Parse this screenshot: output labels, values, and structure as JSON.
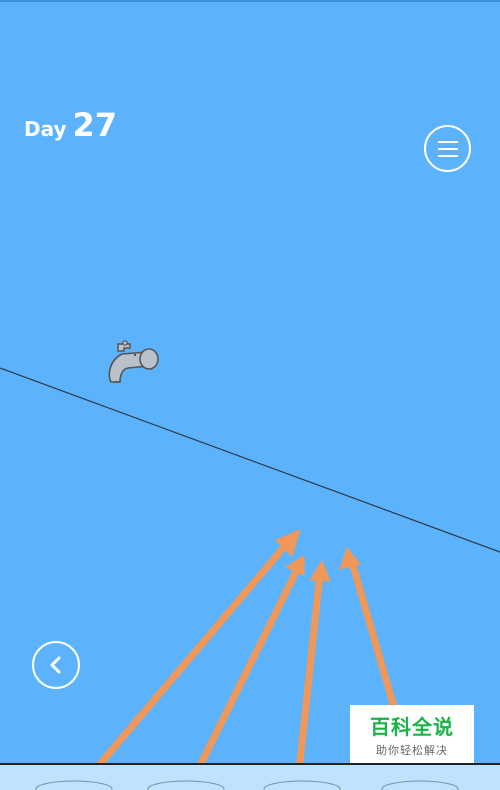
{
  "hud": {
    "day_label": "Day",
    "day_number": "27"
  },
  "icons": {
    "menu": "hamburger-menu-icon",
    "back": "chevron-left-icon",
    "faucet": "water-faucet-icon"
  },
  "watermark": {
    "title": "百科全说",
    "subtitle": "助你轻松解决"
  },
  "colors": {
    "background": "#5db3fb",
    "arrow": "#f0975a",
    "line": "#2b3b4d",
    "ground": "#bfe2ff",
    "watermark_green": "#19b34a"
  }
}
